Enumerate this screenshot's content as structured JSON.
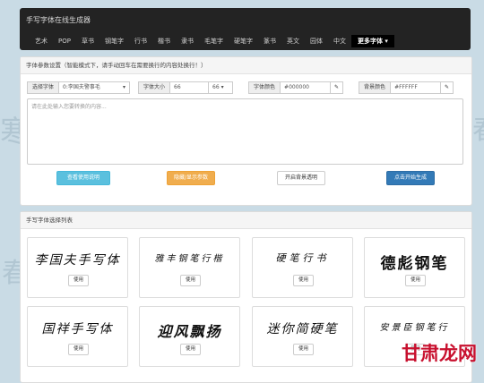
{
  "navbar": {
    "brand": "手写字体在线生成器",
    "items": [
      "艺术",
      "POP",
      "草书",
      "钢笔字",
      "行书",
      "楷书",
      "隶书",
      "毛笔字",
      "硬笔字",
      "篆书",
      "英文",
      "园体",
      "中文"
    ],
    "more": "更多字体 ▾"
  },
  "settings": {
    "title": "字体参数设置（智能模式下，请手动回车在需要换行的内容处换行！）",
    "font_select_label": "选择字体",
    "font_select_value": "0:李国夫警事毛",
    "size_label": "字体大小",
    "size_value": "66",
    "size_dropdown": "66",
    "color_label": "字体颜色",
    "color_value": "#000000",
    "bg_label": "背景颜色",
    "bg_value": "#FFFFFF",
    "textarea_placeholder": "请在此处输入您要转换的内容...",
    "buttons": {
      "help": "查看使用说明",
      "fav": "隐藏/显示参数",
      "transparent": "开启背景透明",
      "generate": "点击开始生成"
    }
  },
  "list": {
    "title": "手写字体选择列表",
    "use_label": "使用",
    "samples": [
      "李国夫手写体",
      "雅丰钢笔行楷",
      "硬笔行书",
      "德彪钢笔",
      "国祥手写体",
      "迎风飘扬",
      "迷你简硬笔",
      "安景臣钢笔行"
    ]
  },
  "watermark": "甘肃龙网"
}
